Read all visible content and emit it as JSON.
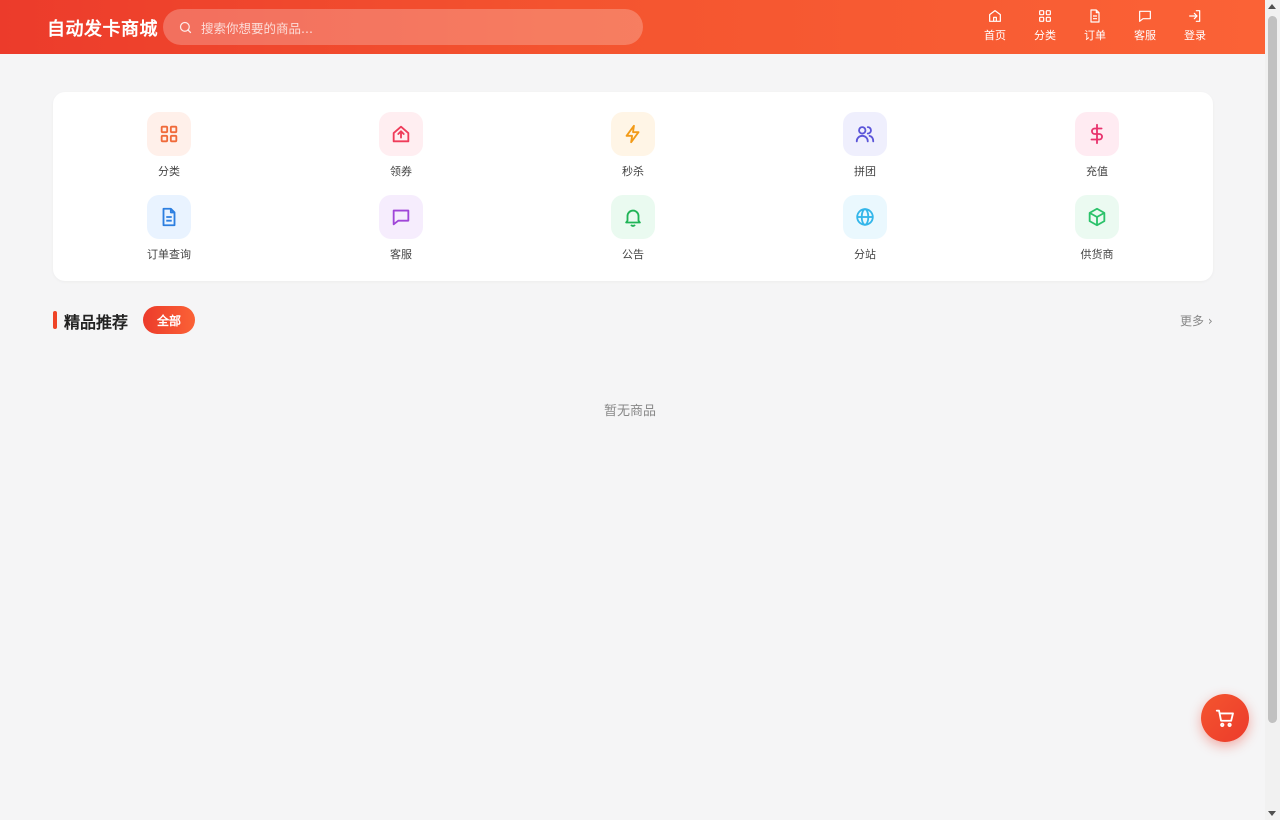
{
  "header": {
    "logo": "自动发卡商城",
    "search_placeholder": "搜索你想要的商品...",
    "nav": [
      {
        "label": "首页",
        "icon": "home-icon"
      },
      {
        "label": "分类",
        "icon": "grid-icon"
      },
      {
        "label": "订单",
        "icon": "document-icon"
      },
      {
        "label": "客服",
        "icon": "chat-icon"
      },
      {
        "label": "登录",
        "icon": "login-icon"
      }
    ]
  },
  "quick": [
    {
      "label": "分类",
      "icon": "grid-icon",
      "color": "#f06a3a",
      "bg": "#fff0ea"
    },
    {
      "label": "领券",
      "icon": "coupon-icon",
      "color": "#ef3c5a",
      "bg": "#ffeef1"
    },
    {
      "label": "秒杀",
      "icon": "lightning-icon",
      "color": "#f29a17",
      "bg": "#fff5e6"
    },
    {
      "label": "拼团",
      "icon": "users-icon",
      "color": "#5b55d9",
      "bg": "#efeffd"
    },
    {
      "label": "充值",
      "icon": "dollar-icon",
      "color": "#e8336e",
      "bg": "#ffebf2"
    },
    {
      "label": "订单查询",
      "icon": "document-icon",
      "color": "#2d7fe0",
      "bg": "#e9f3ff"
    },
    {
      "label": "客服",
      "icon": "chat-icon",
      "color": "#a046d8",
      "bg": "#f6edfd"
    },
    {
      "label": "公告",
      "icon": "bell-icon",
      "color": "#20b457",
      "bg": "#eafaf0"
    },
    {
      "label": "分站",
      "icon": "globe-icon",
      "color": "#33b6ea",
      "bg": "#eaf8fe"
    },
    {
      "label": "供货商",
      "icon": "box-icon",
      "color": "#2bc26a",
      "bg": "#ebfaf1"
    }
  ],
  "section": {
    "title": "精品推荐",
    "tag": "全部",
    "more": "更多 ›"
  },
  "empty_text": "暂无商品",
  "colors": {
    "brand": "#ec3b2b",
    "brand_end": "#fb6236",
    "page_bg": "#f5f5f6"
  }
}
